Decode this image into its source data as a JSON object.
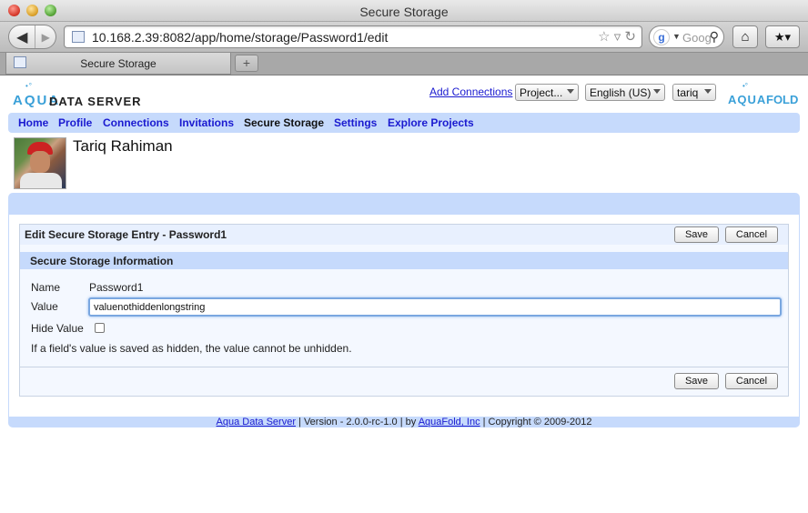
{
  "window": {
    "title": "Secure Storage"
  },
  "browser": {
    "url": "10.168.2.39:8082/app/home/storage/Password1/edit",
    "search_placeholder": "Goog",
    "tab_title": "Secure Storage",
    "new_tab": "+"
  },
  "header": {
    "logo_left": {
      "aqua": "AQUA",
      "product": "DATA SERVER"
    },
    "logo_right": {
      "aqua": "AQUA",
      "fold": "FOLD"
    },
    "add_connections": "Add Connections",
    "project_select": "Project...",
    "language_select": "English (US)",
    "user_select": "tariq"
  },
  "nav": {
    "items": [
      {
        "label": "Home"
      },
      {
        "label": "Profile"
      },
      {
        "label": "Connections"
      },
      {
        "label": "Invitations"
      },
      {
        "label": "Secure Storage"
      },
      {
        "label": "Settings"
      },
      {
        "label": "Explore Projects"
      }
    ]
  },
  "user": {
    "name": "Tariq Rahiman"
  },
  "panel": {
    "title": "Edit Secure Storage Entry - Password1",
    "save": "Save",
    "cancel": "Cancel",
    "section_title": "Secure Storage Information",
    "name_label": "Name",
    "name_value": "Password1",
    "value_label": "Value",
    "value_value": "valuenothiddenlongstring",
    "hide_label": "Hide Value",
    "hint": "If a field's value is saved as hidden, the value cannot be unhidden."
  },
  "footer": {
    "product_link": "Aqua Data Server",
    "version": " | Version - 2.0.0-rc-1.0 | by ",
    "company_link": "AquaFold, Inc",
    "copyright": " | Copyright © 2009-2012"
  },
  "colors": {
    "nav_bar": "#c6dafc",
    "link": "#1a1ad0",
    "logo": "#3aa0d8"
  }
}
